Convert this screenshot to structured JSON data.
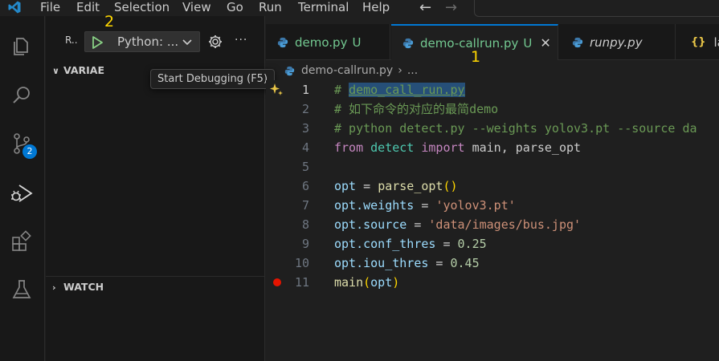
{
  "menu": [
    "File",
    "Edit",
    "Selection",
    "View",
    "Go",
    "Run",
    "Terminal",
    "Help"
  ],
  "nav": {
    "back": "←",
    "forward": "→"
  },
  "activity_bar": {
    "items": [
      "explorer-icon",
      "search-icon",
      "source-control-icon",
      "run-debug-icon",
      "extensions-icon",
      "testing-icon"
    ],
    "source_control_badge": "2"
  },
  "sidebar": {
    "run_label": "R..",
    "config_select": "Python: ...",
    "more": "···",
    "tooltip": "Start Debugging (F5)",
    "variables_header": "VARIABLES",
    "variables_visible": "VARIAE",
    "watch_header": "WATCH"
  },
  "annotations": {
    "a1": "1",
    "a2": "2"
  },
  "tabs": [
    {
      "label": "demo.py",
      "status": "U"
    },
    {
      "label": "demo-callrun.py",
      "status": "U",
      "close": "✕"
    },
    {
      "label": "runpy.py"
    },
    {
      "label": "la",
      "icon": "{}"
    }
  ],
  "breadcrumb": {
    "file": "demo-callrun.py",
    "sep": "›",
    "rest": "..."
  },
  "editor": {
    "line_numbers": [
      "1",
      "2",
      "3",
      "4",
      "5",
      "6",
      "7",
      "8",
      "9",
      "10",
      "11"
    ],
    "lines": {
      "l1": {
        "hash": "# ",
        "highlight": "demo_call_run.py"
      },
      "l2": "# 如下命令的对应的最简demo",
      "l3": "# python detect.py --weights yolov3.pt --source da",
      "l4": {
        "from": "from",
        "mod": "detect",
        "import": "import",
        "rest": "main, parse_opt"
      },
      "l6": {
        "var": "opt",
        "eq": " = ",
        "fn": "parse_opt",
        "open": "(",
        "close": ")"
      },
      "l7": {
        "var": "opt",
        "attr": ".weights",
        "eq": " = ",
        "str": "'yolov3.pt'"
      },
      "l8": {
        "var": "opt",
        "attr": ".source",
        "eq": " = ",
        "str": "'data/images/bus.jpg'"
      },
      "l9": {
        "var": "opt",
        "attr": ".conf_thres",
        "eq": " = ",
        "num": "0.25"
      },
      "l10": {
        "var": "opt",
        "attr": ".iou_thres",
        "eq": " = ",
        "num": "0.45"
      },
      "l11": {
        "fn": "main",
        "open": "(",
        "arg": "opt",
        "close": ")"
      }
    }
  },
  "colors": {
    "accent": "#0078d4",
    "untracked": "#73c991",
    "comment": "#6a9955",
    "keyword": "#c586c0",
    "string": "#ce9178",
    "number": "#b5cea8",
    "breakpoint": "#e51400",
    "annotation": "#ffd700"
  }
}
